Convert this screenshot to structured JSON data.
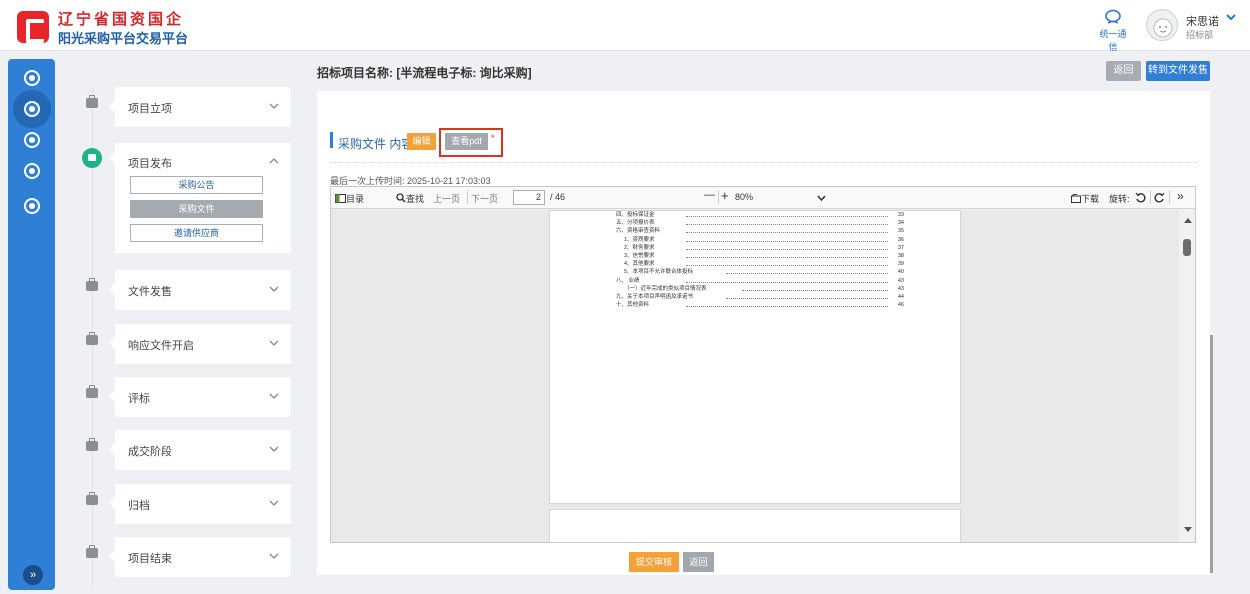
{
  "header": {
    "logo_line1": "辽宁省国资国企",
    "logo_line2": "阳光采购平台交易平台",
    "chat_label": "统一通信",
    "user_name": "宋思诺",
    "user_dept": "招标部"
  },
  "page": {
    "title": "招标项目名称: [半流程电子标: 询比采购]",
    "back_label": "返回",
    "turn_label": "转到文件发售"
  },
  "steps": [
    {
      "label": "项目立项",
      "expanded": false
    },
    {
      "label": "项目发布",
      "expanded": true,
      "sub": [
        "采购公告",
        "采购文件",
        "邀请供应商"
      ],
      "active_sub": 1
    },
    {
      "label": "文件发售",
      "expanded": false
    },
    {
      "label": "响应文件开启",
      "expanded": false
    },
    {
      "label": "评标",
      "expanded": false
    },
    {
      "label": "成交阶段",
      "expanded": false
    },
    {
      "label": "归档",
      "expanded": false
    },
    {
      "label": "项目结束",
      "expanded": false
    }
  ],
  "section": {
    "title": "采购文件 内容",
    "edit_label": "编辑",
    "viewpdf_label": "查看pdf",
    "asterisk": "*",
    "upload_time": "最后一次上传时间: 2025-10-21 17:03:03"
  },
  "pdf": {
    "toc_label": "目录",
    "find_label": "查找",
    "prev_label": "上一页",
    "next_label": "下一页",
    "page_current": "2",
    "page_total": "/ 46",
    "zoom_minus": "—",
    "zoom_plus": "+",
    "zoom": "80%",
    "download_label": "下载",
    "rotate_label": "旋转:",
    "more": "»",
    "toc": [
      {
        "text": "四、投标保证金",
        "page": "33"
      },
      {
        "text": "五、分项报价表",
        "page": "34"
      },
      {
        "text": "六、资格审查资料",
        "page": "35"
      },
      {
        "text": "1、资质要求",
        "page": "36"
      },
      {
        "text": "2、财务要求",
        "page": "37"
      },
      {
        "text": "3、信誉要求",
        "page": "38"
      },
      {
        "text": "4、其他要求",
        "page": "39"
      },
      {
        "text": "5、本项目不允许联合体投标",
        "page": "40"
      },
      {
        "text": "八、 业绩",
        "page": "43"
      },
      {
        "text": "（一）近年完成的类似项目情况表",
        "page": "43"
      },
      {
        "text": "九、关于本项目声明函及承诺书",
        "page": "44"
      },
      {
        "text": "十、其他资料",
        "page": "46"
      }
    ]
  },
  "footer": {
    "submit_label": "提交审核",
    "back_label": "返回"
  },
  "colors": {
    "primary": "#2f7fd6",
    "orange": "#f5a13a",
    "highlight_red": "#e0301e",
    "active_green": "#1db386"
  }
}
